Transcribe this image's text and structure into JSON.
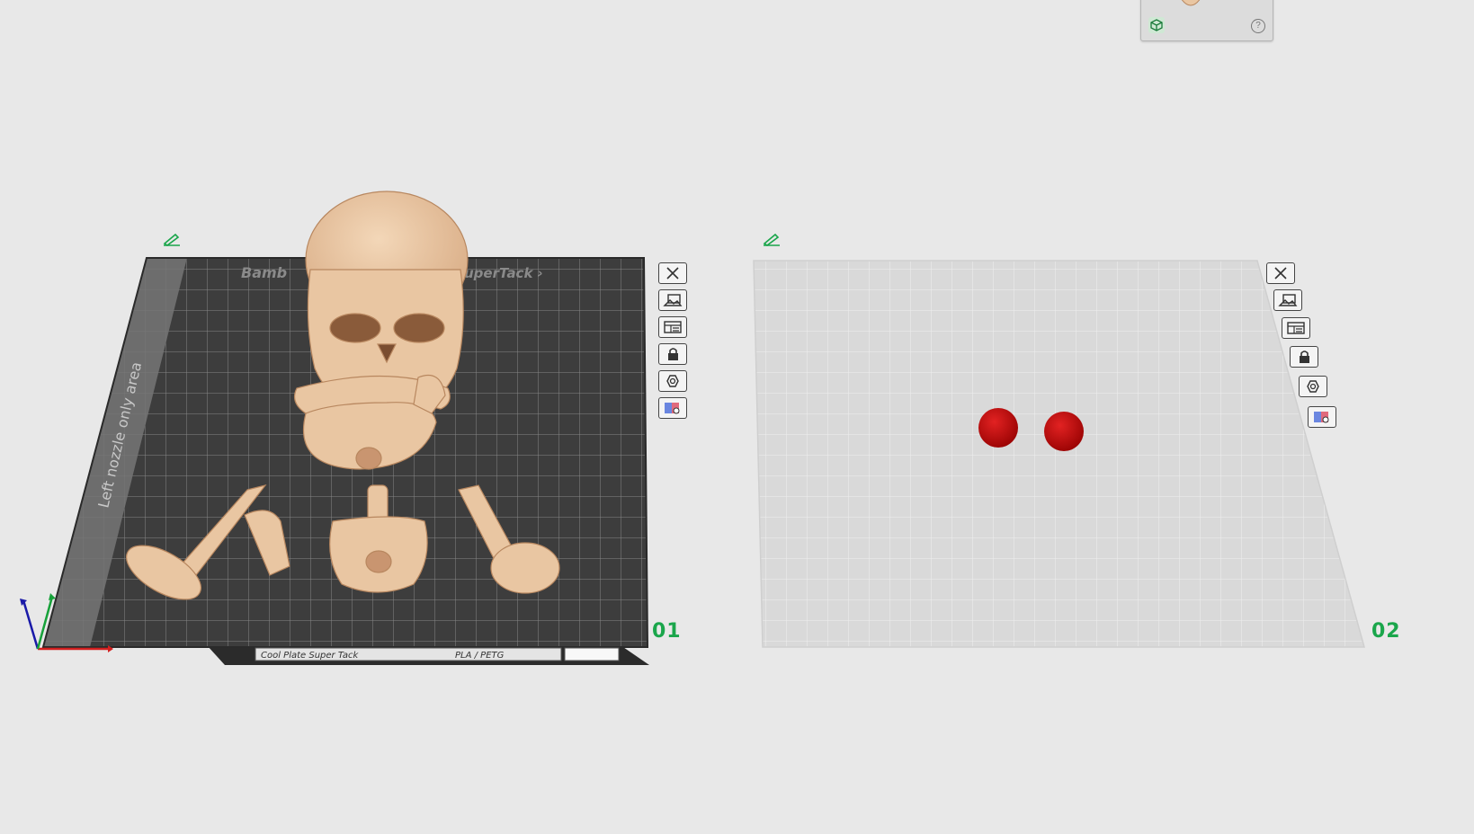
{
  "plates": [
    {
      "number": "01",
      "theme": "dark",
      "brand_text_left": "Bamb",
      "brand_text_right": "uperTack ›",
      "side_label": "Left nozzle only area",
      "footer_plate_type": "Cool Plate Super Tack",
      "footer_filament": "PLA / PETG"
    },
    {
      "number": "02",
      "theme": "light"
    }
  ],
  "plate_toolbar": [
    {
      "name": "delete-plate-button",
      "icon": "close-icon"
    },
    {
      "name": "orient-plate-button",
      "icon": "orient-icon"
    },
    {
      "name": "arrange-plate-button",
      "icon": "arrange-icon"
    },
    {
      "name": "lock-plate-button",
      "icon": "lock-icon"
    },
    {
      "name": "plate-settings-button",
      "icon": "settings-hex-icon"
    },
    {
      "name": "filament-view-button",
      "icon": "filament-eye-icon"
    }
  ],
  "colors": {
    "background": "#e8e8e8",
    "plate_dark": "#3d3d3d",
    "plate_light": "#d9d9d9",
    "model_skin": "#e9c6a2",
    "model_red": "#c40d0d",
    "plate_number": "#1aa64b"
  },
  "thumbnail": {
    "help": "?"
  }
}
